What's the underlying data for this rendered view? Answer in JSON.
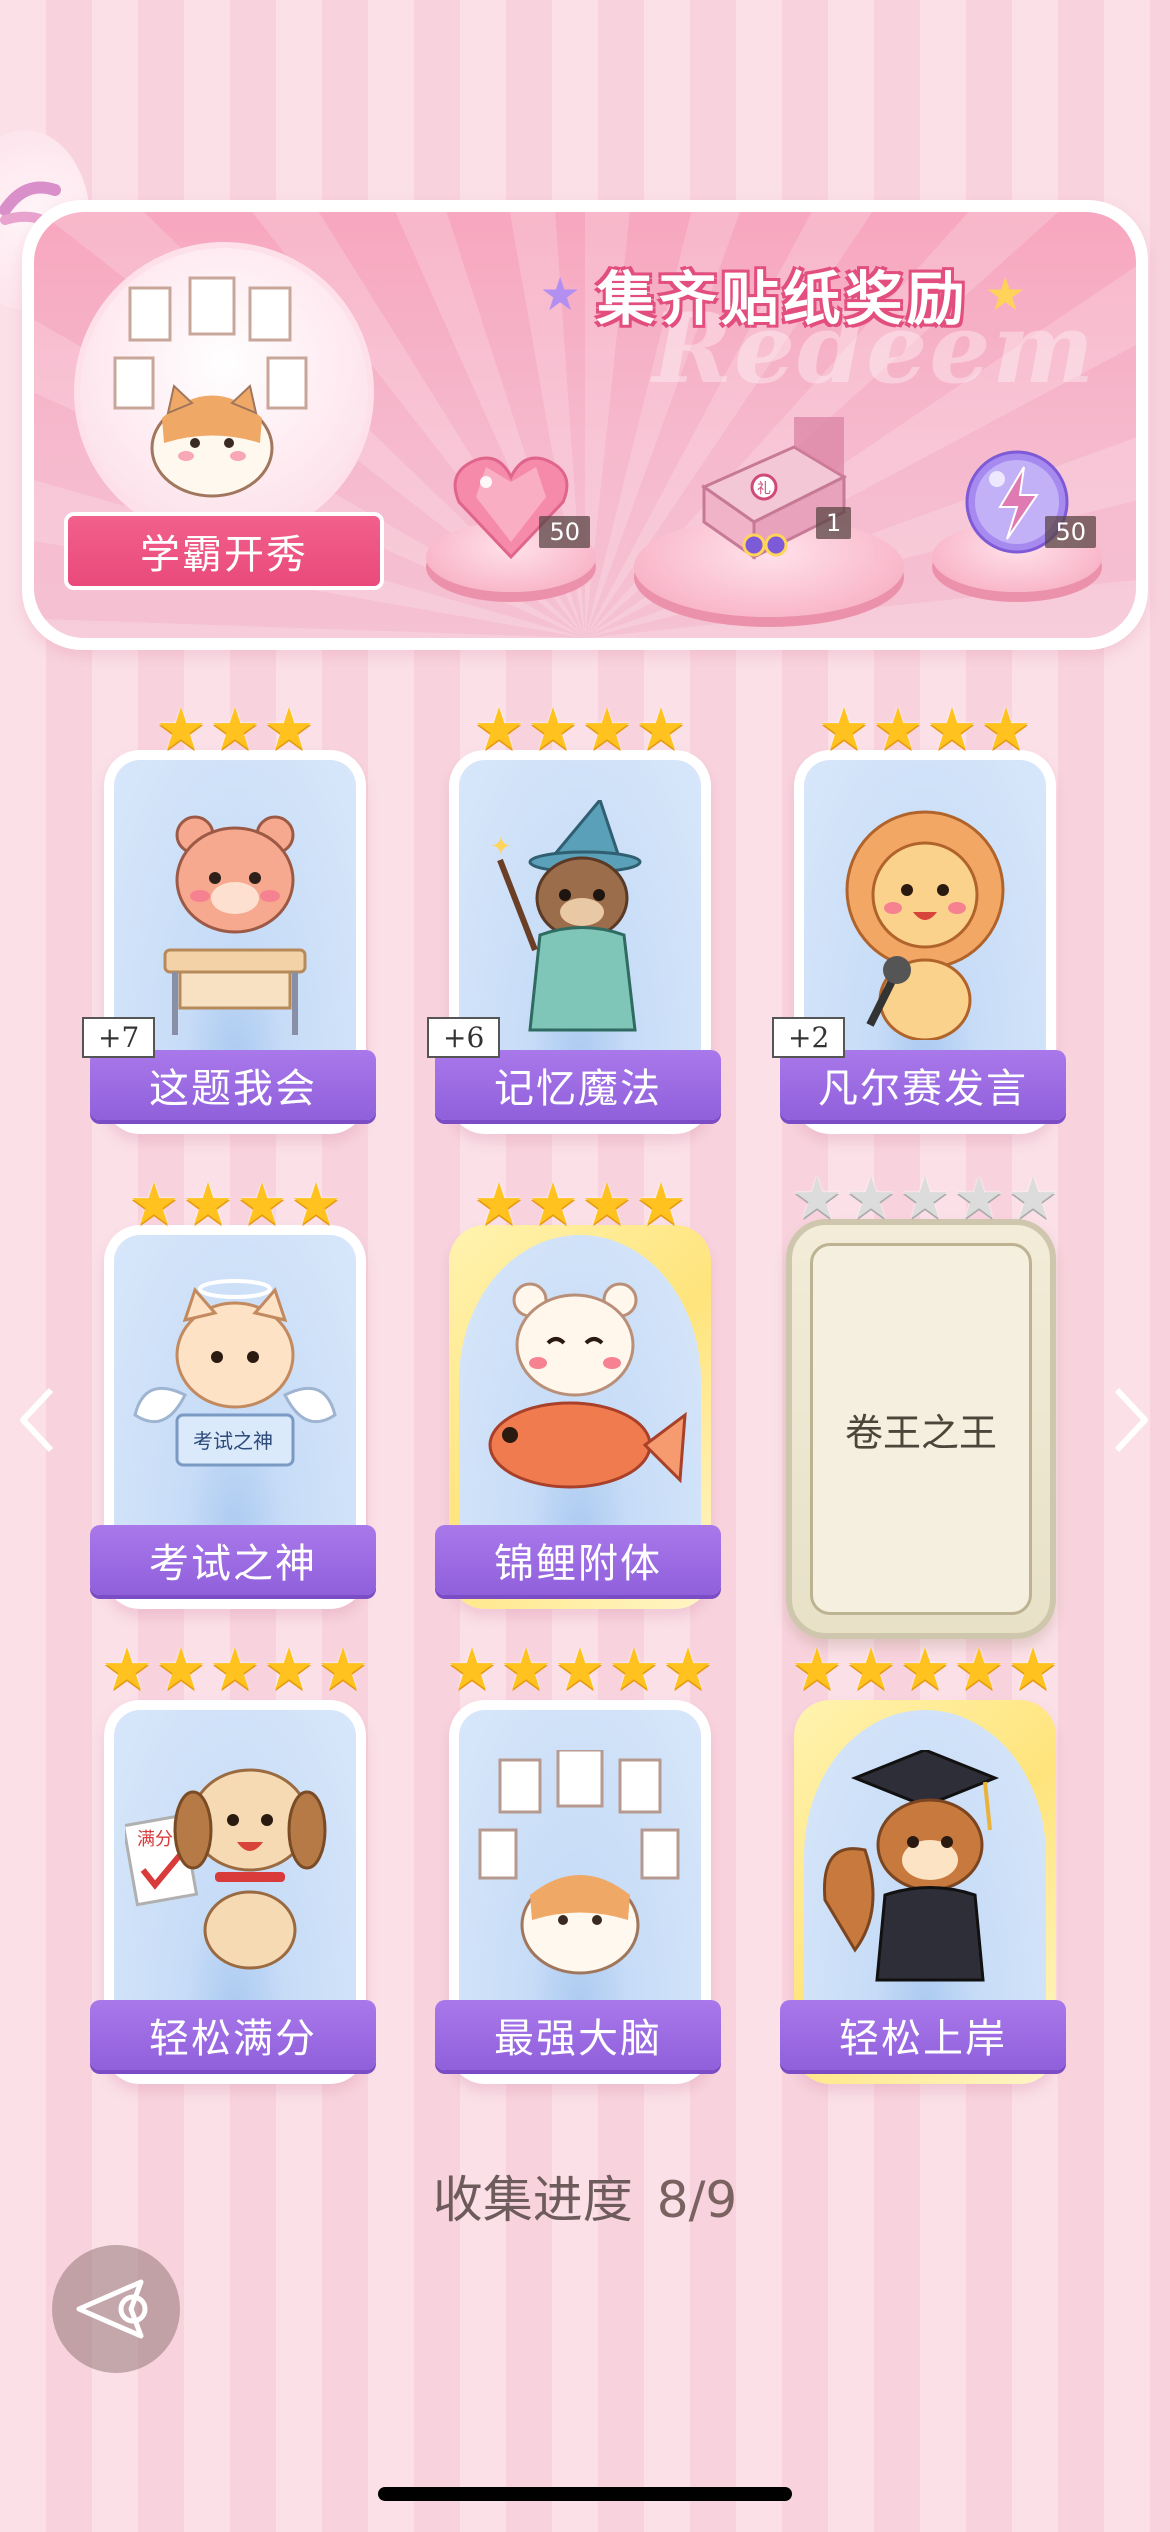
{
  "banner": {
    "title": "集齐贴纸奖励",
    "watermark": "Redeem",
    "badge_label": "学霸开秀",
    "rewards": [
      {
        "icon": "heart-gem-icon",
        "count": "50"
      },
      {
        "icon": "gift-box-icon",
        "count": "1"
      },
      {
        "icon": "energy-orb-icon",
        "count": "50"
      }
    ]
  },
  "stickers": [
    {
      "label": "这题我会",
      "stars": 3,
      "plus": "+7",
      "art": "bear-at-desk"
    },
    {
      "label": "记忆魔法",
      "stars": 4,
      "plus": "+6",
      "art": "otter-wizard"
    },
    {
      "label": "凡尔赛发言",
      "stars": 4,
      "plus": "+2",
      "art": "lion-microphone"
    },
    {
      "label": "考试之神",
      "stars": 4,
      "art": "angel-cat"
    },
    {
      "label": "锦鲤附体",
      "stars": 4,
      "art": "bear-with-koi",
      "gold": true
    },
    {
      "label": "卷王之王",
      "stars": 5,
      "locked": true
    },
    {
      "label": "轻松满分",
      "stars": 5,
      "art": "puppy-full-score"
    },
    {
      "label": "最强大脑",
      "stars": 5,
      "art": "cat-with-papers"
    },
    {
      "label": "轻松上岸",
      "stars": 5,
      "art": "squirrel-graduate",
      "gold": true
    }
  ],
  "progress": {
    "label": "收集进度",
    "value": "8/9"
  },
  "colors": {
    "accent": "#9060dc",
    "banner_pink": "#f7a7bf",
    "title_stroke": "#e24f7e",
    "star_gold": "#ffc21e"
  }
}
